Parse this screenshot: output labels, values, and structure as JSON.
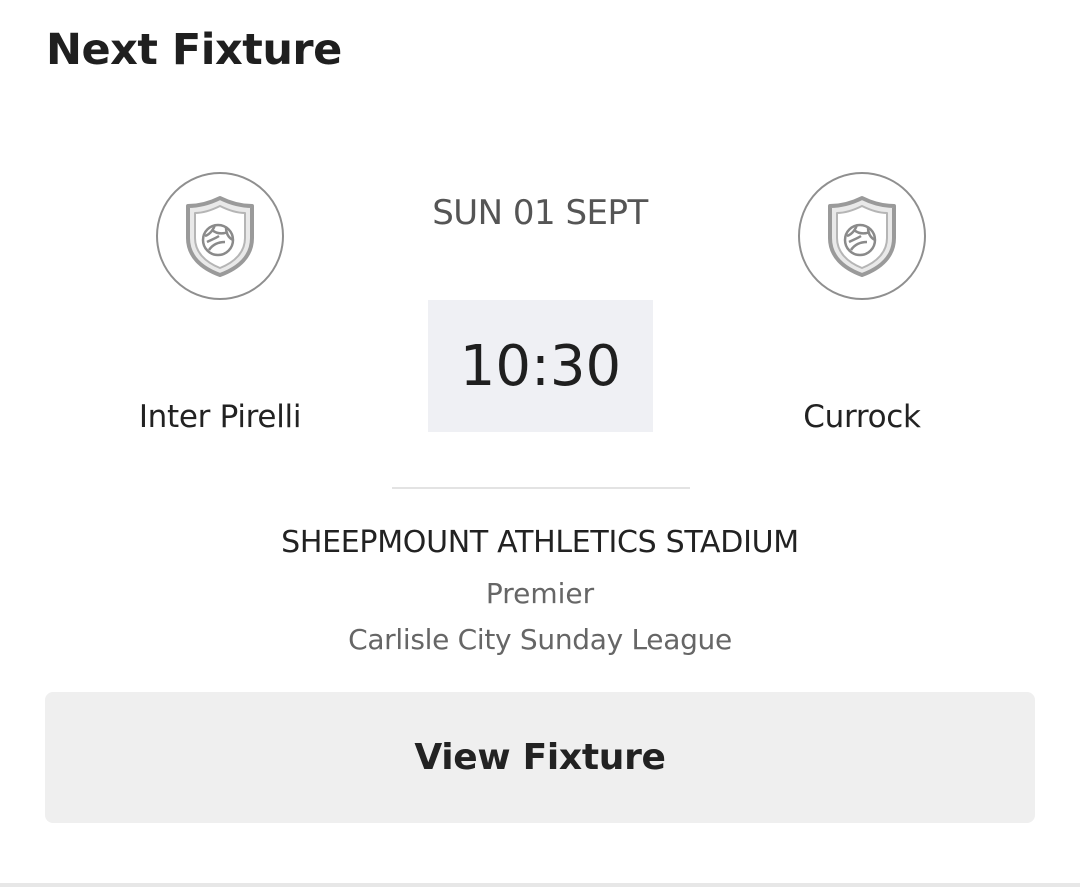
{
  "header": {
    "title": "Next Fixture"
  },
  "fixture": {
    "home_team": {
      "name": "Inter Pirelli",
      "crest_icon": "shield-football-icon"
    },
    "away_team": {
      "name": "Currock",
      "crest_icon": "shield-football-icon"
    },
    "date": "SUN 01 SEPT",
    "time": "10:30",
    "venue": "SHEEPMOUNT ATHLETICS STADIUM",
    "division": "Premier",
    "league": "Carlisle City Sunday League"
  },
  "actions": {
    "view_fixture_label": "View Fixture"
  },
  "colors": {
    "time_box_bg": "#eff0f4",
    "button_bg": "#efefef",
    "crest_border": "#8f8f8f"
  }
}
